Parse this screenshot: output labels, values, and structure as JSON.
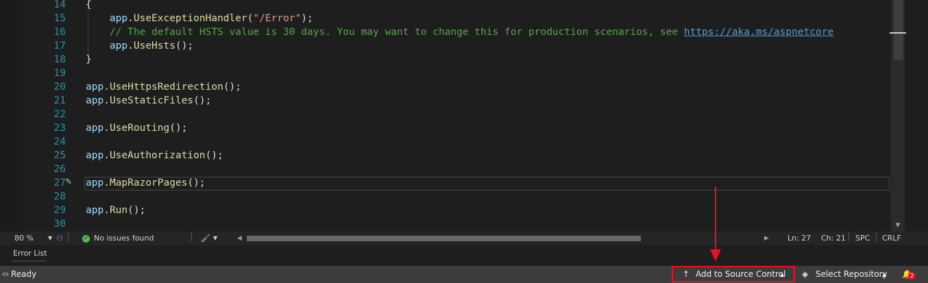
{
  "editor": {
    "lines": [
      {
        "num": "14",
        "parts": [
          {
            "t": "{",
            "c": ""
          }
        ]
      },
      {
        "num": "15",
        "parts": [
          {
            "t": "    ",
            "c": ""
          },
          {
            "t": "app",
            "c": "kw-app"
          },
          {
            "t": ".",
            "c": ""
          },
          {
            "t": "UseExceptionHandler",
            "c": "fn"
          },
          {
            "t": "(",
            "c": ""
          },
          {
            "t": "\"/Error\"",
            "c": "str"
          },
          {
            "t": ");",
            "c": ""
          }
        ]
      },
      {
        "num": "16",
        "parts": [
          {
            "t": "    ",
            "c": ""
          },
          {
            "t": "// The default HSTS value is 30 days. You may want to change this for production scenarios, see ",
            "c": "cmt"
          },
          {
            "t": "https://aka.ms/aspnetcore",
            "c": "lnk"
          }
        ]
      },
      {
        "num": "17",
        "parts": [
          {
            "t": "    ",
            "c": ""
          },
          {
            "t": "app",
            "c": "kw-app"
          },
          {
            "t": ".",
            "c": ""
          },
          {
            "t": "UseHsts",
            "c": "fn"
          },
          {
            "t": "();",
            "c": ""
          }
        ]
      },
      {
        "num": "18",
        "parts": [
          {
            "t": "}",
            "c": ""
          }
        ]
      },
      {
        "num": "19",
        "parts": []
      },
      {
        "num": "20",
        "parts": [
          {
            "t": "app",
            "c": "kw-app"
          },
          {
            "t": ".",
            "c": ""
          },
          {
            "t": "UseHttpsRedirection",
            "c": "fn"
          },
          {
            "t": "();",
            "c": ""
          }
        ]
      },
      {
        "num": "21",
        "parts": [
          {
            "t": "app",
            "c": "kw-app"
          },
          {
            "t": ".",
            "c": ""
          },
          {
            "t": "UseStaticFiles",
            "c": "fn"
          },
          {
            "t": "();",
            "c": ""
          }
        ]
      },
      {
        "num": "22",
        "parts": []
      },
      {
        "num": "23",
        "parts": [
          {
            "t": "app",
            "c": "kw-app"
          },
          {
            "t": ".",
            "c": ""
          },
          {
            "t": "UseRouting",
            "c": "fn"
          },
          {
            "t": "();",
            "c": ""
          }
        ]
      },
      {
        "num": "24",
        "parts": []
      },
      {
        "num": "25",
        "parts": [
          {
            "t": "app",
            "c": "kw-app"
          },
          {
            "t": ".",
            "c": ""
          },
          {
            "t": "UseAuthorization",
            "c": "fn"
          },
          {
            "t": "();",
            "c": ""
          }
        ]
      },
      {
        "num": "26",
        "parts": []
      },
      {
        "num": "27",
        "parts": [
          {
            "t": "app",
            "c": "kw-app"
          },
          {
            "t": ".",
            "c": ""
          },
          {
            "t": "MapRazorPages",
            "c": "fn"
          },
          {
            "t": "();",
            "c": ""
          }
        ]
      },
      {
        "num": "28",
        "parts": []
      },
      {
        "num": "29",
        "parts": [
          {
            "t": "app",
            "c": "kw-app"
          },
          {
            "t": ".",
            "c": ""
          },
          {
            "t": "Run",
            "c": "fn"
          },
          {
            "t": "();",
            "c": ""
          }
        ]
      },
      {
        "num": "30",
        "parts": []
      }
    ]
  },
  "editor_status": {
    "zoom": "80 %",
    "issues": "No issues found",
    "line": "Ln: 27",
    "col": "Ch: 21",
    "whitespace": "SPC",
    "line_ending": "CRLF"
  },
  "panel": {
    "error_list_tab": "Error List"
  },
  "status_bar": {
    "ready": "Ready",
    "add_to_source_control": "Add to Source Control",
    "select_repository": "Select Repository",
    "notification_count": "2"
  },
  "colors": {
    "highlight": "#e81123",
    "line_number": "#2b91af",
    "status_bar": "#3c3c3c"
  }
}
